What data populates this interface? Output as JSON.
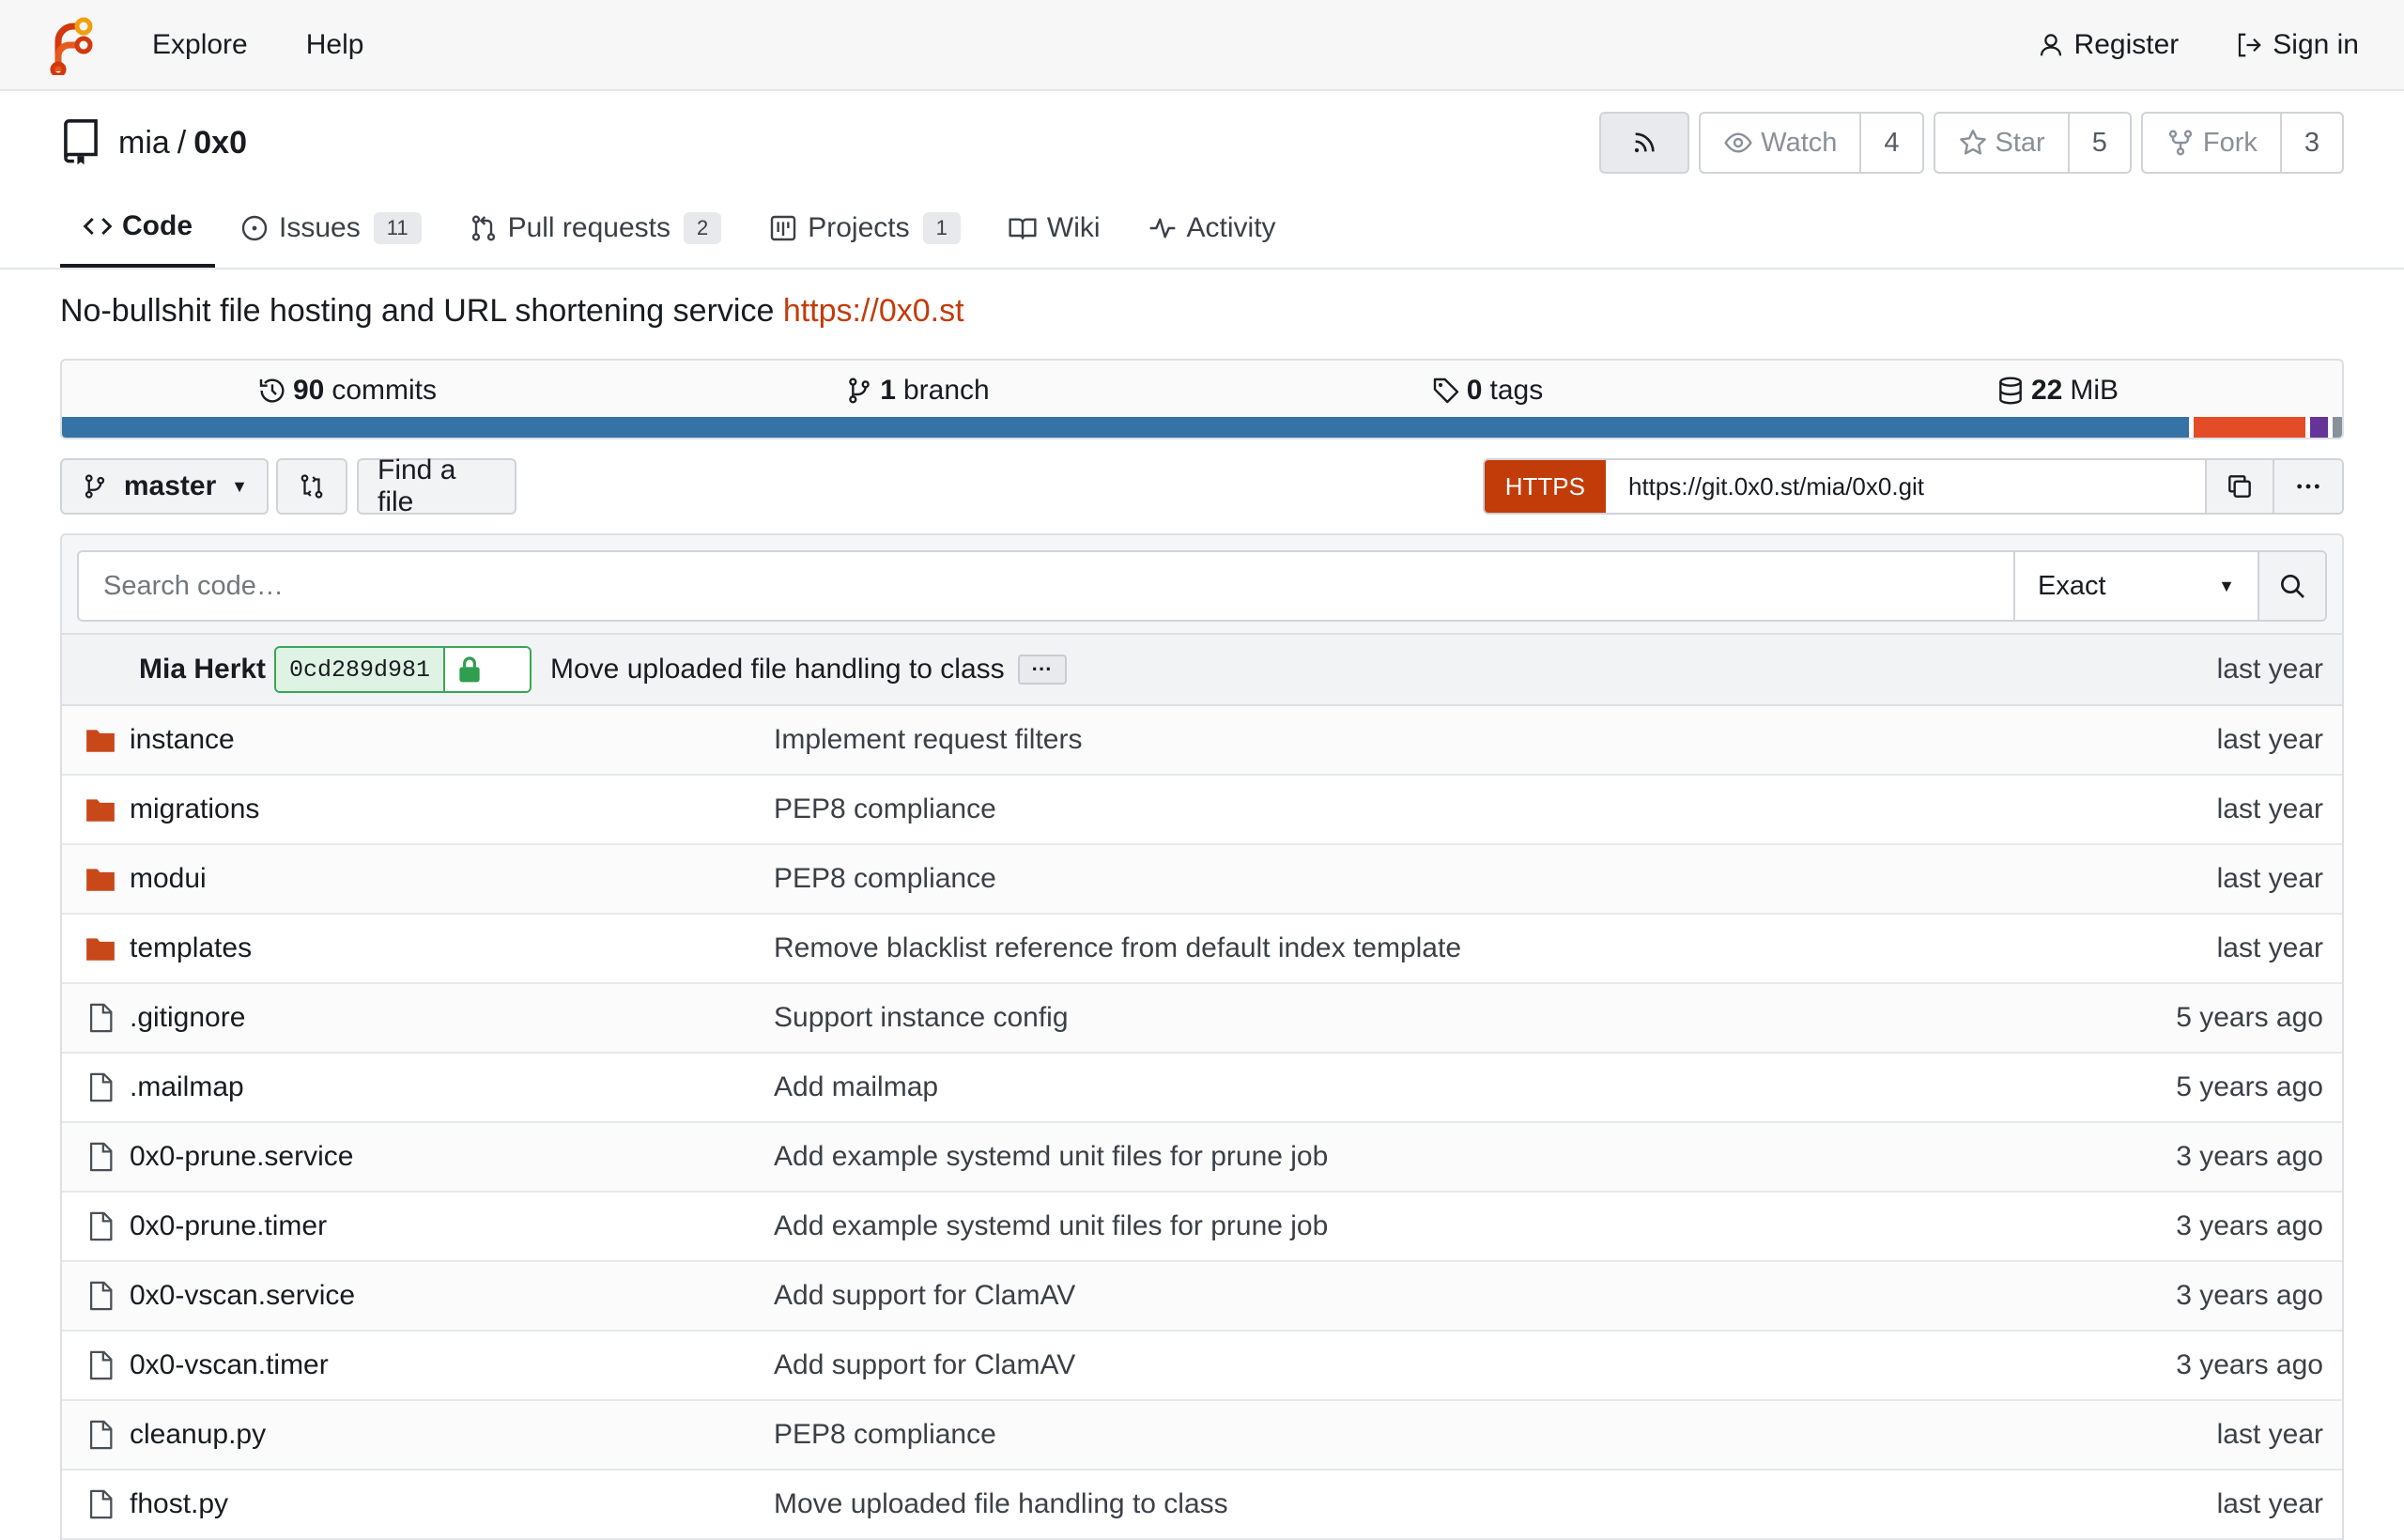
{
  "nav": {
    "explore": "Explore",
    "help": "Help",
    "register": "Register",
    "sign_in": "Sign in",
    "logo_icon": "forgejo-logo"
  },
  "repo": {
    "owner": "mia",
    "separator": "/",
    "name": "0x0",
    "watch_label": "Watch",
    "watch_count": "4",
    "star_label": "Star",
    "star_count": "5",
    "fork_label": "Fork",
    "fork_count": "3"
  },
  "tabs": [
    {
      "label": "Code",
      "icon": "code-icon"
    },
    {
      "label": "Issues",
      "badge": "11",
      "icon": "issue-icon"
    },
    {
      "label": "Pull requests",
      "badge": "2",
      "icon": "pull-request-icon"
    },
    {
      "label": "Projects",
      "badge": "1",
      "icon": "project-icon"
    },
    {
      "label": "Wiki",
      "icon": "book-icon"
    },
    {
      "label": "Activity",
      "icon": "pulse-icon"
    }
  ],
  "description": {
    "text": "No-bullshit file hosting and URL shortening service",
    "link": "https://0x0.st"
  },
  "stats": {
    "commits_num": "90",
    "commits_label": "commits",
    "branch_num": "1",
    "branch_label": "branch",
    "tags_num": "0",
    "tags_label": "tags",
    "size_num": "22",
    "size_unit": "MiB"
  },
  "language_bar": [
    {
      "fraction": 0.933,
      "color": "#3572a5"
    },
    {
      "fraction": 0.002,
      "color": "#ffffff"
    },
    {
      "fraction": 0.049,
      "color": "#e34c26"
    },
    {
      "fraction": 0.002,
      "color": "#ffffff"
    },
    {
      "fraction": 0.008,
      "color": "#663399"
    },
    {
      "fraction": 0.002,
      "color": "#ffffff"
    },
    {
      "fraction": 0.004,
      "color": "#89929b"
    }
  ],
  "toolbar": {
    "branch": "master",
    "find_file": "Find a file",
    "clone_protocol": "HTTPS",
    "clone_url": "https://git.0x0.st/mia/0x0.git"
  },
  "search": {
    "placeholder": "Search code…",
    "mode": "Exact"
  },
  "latest_commit": {
    "author": "Mia Herkt",
    "sha": "0cd289d981",
    "message": "Move uploaded file handling to class",
    "when": "last year"
  },
  "files": [
    {
      "name": "instance",
      "type": "dir",
      "message": "Implement request filters",
      "when": "last year"
    },
    {
      "name": "migrations",
      "type": "dir",
      "message": "PEP8 compliance",
      "when": "last year"
    },
    {
      "name": "modui",
      "type": "dir",
      "message": "PEP8 compliance",
      "when": "last year"
    },
    {
      "name": "templates",
      "type": "dir",
      "message": "Remove blacklist reference from default index template",
      "when": "last year"
    },
    {
      "name": ".gitignore",
      "type": "file",
      "message": "Support instance config",
      "when": "5 years ago"
    },
    {
      "name": ".mailmap",
      "type": "file",
      "message": "Add mailmap",
      "when": "5 years ago"
    },
    {
      "name": "0x0-prune.service",
      "type": "file",
      "message": "Add example systemd unit files for prune job",
      "when": "3 years ago"
    },
    {
      "name": "0x0-prune.timer",
      "type": "file",
      "message": "Add example systemd unit files for prune job",
      "when": "3 years ago"
    },
    {
      "name": "0x0-vscan.service",
      "type": "file",
      "message": "Add support for ClamAV",
      "when": "3 years ago"
    },
    {
      "name": "0x0-vscan.timer",
      "type": "file",
      "message": "Add support for ClamAV",
      "when": "3 years ago"
    },
    {
      "name": "cleanup.py",
      "type": "file",
      "message": "PEP8 compliance",
      "when": "last year"
    },
    {
      "name": "fhost.py",
      "type": "file",
      "message": "Move uploaded file handling to class",
      "when": "last year"
    }
  ],
  "colors": {
    "accent": "#c23c0a",
    "folder": "#c8481a",
    "sha_green": "#3aa655"
  }
}
